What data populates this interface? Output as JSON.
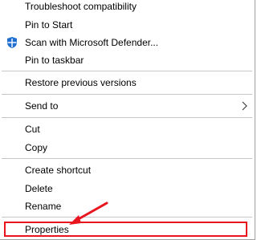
{
  "context_menu": {
    "items": [
      {
        "label": "Troubleshoot compatibility"
      },
      {
        "label": "Pin to Start"
      },
      {
        "label": "Scan with Microsoft Defender..."
      },
      {
        "label": "Pin to taskbar"
      },
      {
        "label": "Restore previous versions"
      },
      {
        "label": "Send to"
      },
      {
        "label": "Cut"
      },
      {
        "label": "Copy"
      },
      {
        "label": "Create shortcut"
      },
      {
        "label": "Delete"
      },
      {
        "label": "Rename"
      },
      {
        "label": "Properties"
      }
    ]
  },
  "annotation": {
    "highlight_color": "#e8141e",
    "highlighted_item": "Properties"
  },
  "icons": {
    "defender": "shield-icon",
    "send_to_arrow": "chevron-right-icon"
  }
}
